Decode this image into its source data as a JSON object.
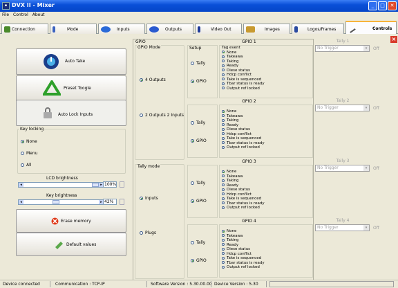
{
  "window": {
    "title": "DVX II - Mixer"
  },
  "menu": [
    "File",
    "Control",
    "About"
  ],
  "tabs": [
    "Connection",
    "Mode",
    "Inputs",
    "Outputs",
    "Video Out",
    "Images",
    "Logos/Frames",
    "Controls"
  ],
  "left": {
    "auto_take": "Auto Take",
    "preset_toogle": "Preset Toogle",
    "auto_lock": "Auto Lock Inputs",
    "key_locking": "Key locking",
    "key_none": "None",
    "key_menu": "Menu",
    "key_all": "All",
    "lcd_brightness": "LCD brightness",
    "lcd_value": "100%",
    "lcd_level": 1.0,
    "key_brightness": "Key brightness",
    "key_value": "42%",
    "key_level": 0.42,
    "erase_memory": "Erase memory",
    "default_values": "Default values"
  },
  "center": {
    "gpio_label": "GPIO",
    "gpio_mode": "GPIO Mode",
    "mode_4out": "4 Outputs",
    "mode_2out2in": "2 Outputs 2 Inputs",
    "tally_mode": "Tally mode",
    "tally_inputs": "Inputs",
    "tally_plugs": "Plugs",
    "setup": "Setup",
    "tag_event": "Tag event",
    "opt_tally": "Tally",
    "opt_gpio": "GPIO",
    "events": [
      "None",
      "Takeawa",
      "Taking",
      "Ready",
      "Diese status",
      "Hdcp conflict",
      "Take is sequenced",
      "Tbar status is ready",
      "Output ref locked"
    ],
    "gpios": [
      "GPIO 1",
      "GPIO 2",
      "GPIO 3",
      "GPIO 4"
    ]
  },
  "right": {
    "tallies": [
      "Tally 1",
      "Tally 2",
      "Tally 3",
      "Tally 4"
    ],
    "combo_value": "No Trigger",
    "off": "Off"
  },
  "status": {
    "device": "Device connected",
    "comm": "Communication : TCP-IP",
    "software": "Software Version : 5.30.00.00",
    "device_version": "Device Version : 5.30"
  }
}
